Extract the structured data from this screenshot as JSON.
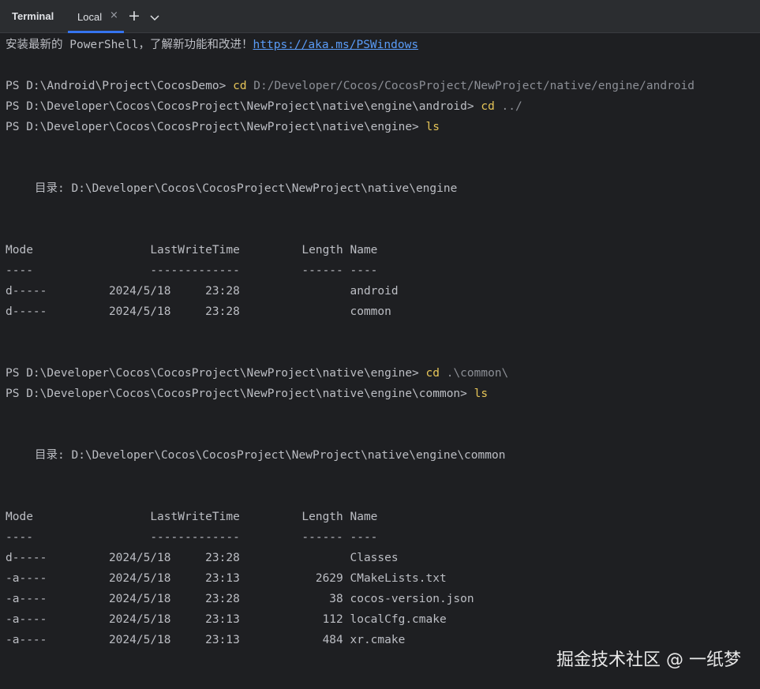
{
  "tabbar": {
    "title": "Terminal",
    "tab_label": "Local",
    "close_glyph": "×",
    "add_glyph": "+",
    "menu_icon": "chevron-down-icon"
  },
  "colors": {
    "background": "#1e1f22",
    "tabbar": "#2b2d30",
    "accent": "#3574f0",
    "command": "#e6c558",
    "argument": "#8c8f96",
    "link": "#5a9cf8",
    "text": "#bcbec4"
  },
  "terminal": {
    "banner_text": "安装最新的 PowerShell，了解新功能和改进！",
    "banner_link": "https://aka.ms/PSWindows",
    "session1": [
      {
        "prompt": "PS D:\\Android\\Project\\CocosDemo> ",
        "cmd": "cd",
        "arg": " D:/Developer/Cocos/CocosProject/NewProject/native/engine/android"
      },
      {
        "prompt": "PS D:\\Developer\\Cocos\\CocosProject\\NewProject\\native\\engine\\android> ",
        "cmd": "cd",
        "arg": " ../"
      },
      {
        "prompt": "PS D:\\Developer\\Cocos\\CocosProject\\NewProject\\native\\engine> ",
        "cmd": "ls",
        "arg": ""
      }
    ],
    "listing1": {
      "directory_line": "目录: D:\\Developer\\Cocos\\CocosProject\\NewProject\\native\\engine",
      "header_line": "Mode                 LastWriteTime         Length Name",
      "separator_line": "----                 -------------         ------ ----",
      "rows": [
        "d-----         2024/5/18     23:28                android",
        "d-----         2024/5/18     23:28                common"
      ]
    },
    "session2": [
      {
        "prompt": "PS D:\\Developer\\Cocos\\CocosProject\\NewProject\\native\\engine> ",
        "cmd": "cd",
        "arg": " .\\common\\"
      },
      {
        "prompt": "PS D:\\Developer\\Cocos\\CocosProject\\NewProject\\native\\engine\\common> ",
        "cmd": "ls",
        "arg": ""
      }
    ],
    "listing2": {
      "directory_line": "目录: D:\\Developer\\Cocos\\CocosProject\\NewProject\\native\\engine\\common",
      "header_line": "Mode                 LastWriteTime         Length Name",
      "separator_line": "----                 -------------         ------ ----",
      "rows": [
        "d-----         2024/5/18     23:28                Classes",
        "-a----         2024/5/18     23:13           2629 CMakeLists.txt",
        "-a----         2024/5/18     23:28             38 cocos-version.json",
        "-a----         2024/5/18     23:13            112 localCfg.cmake",
        "-a----         2024/5/18     23:13            484 xr.cmake"
      ]
    }
  },
  "watermark": "掘金技术社区 @ 一纸梦"
}
